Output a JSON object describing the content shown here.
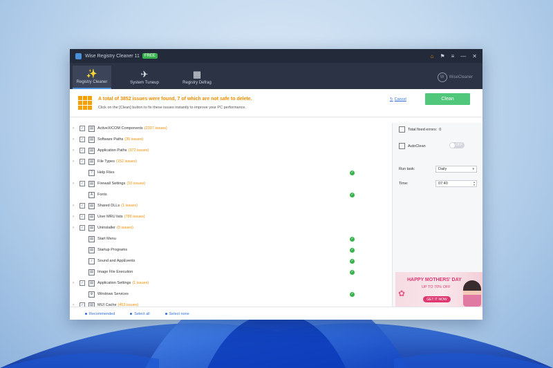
{
  "app": {
    "title": "Wise Registry Cleaner 11",
    "badge": "FREE",
    "brand": "WiseCleaner",
    "controls": [
      "⌂",
      "⚑",
      "≡",
      "—",
      "✕"
    ]
  },
  "nav": {
    "tabs": [
      {
        "label": "Registry Cleaner",
        "icon": "✨"
      },
      {
        "label": "System Tuneup",
        "icon": "✈"
      },
      {
        "label": "Registry Defrag",
        "icon": "▦"
      }
    ]
  },
  "summary": {
    "headline": "A total of 3852 issues were found, 7 of which are not safe to delete.",
    "hint": "Click on the [Clean] button to fix these issues instantly to improve your PC performance.",
    "cancel_label": "Cancel",
    "clean_label": "Clean"
  },
  "items": [
    {
      "label": "ActiveX/COM Components",
      "count": "(2337 issues)",
      "expandable": true,
      "checkbox": true,
      "icon": "▤",
      "ok": false
    },
    {
      "label": "Software Paths",
      "count": "(35 issues)",
      "expandable": true,
      "checkbox": true,
      "icon": "▤",
      "ok": false
    },
    {
      "label": "Application Paths",
      "count": "(372 issues)",
      "expandable": true,
      "checkbox": true,
      "icon": "▤",
      "ok": false
    },
    {
      "label": "File Types",
      "count": "(152 issues)",
      "expandable": true,
      "checkbox": true,
      "icon": "▤",
      "ok": false
    },
    {
      "label": "Help Files",
      "count": "",
      "expandable": false,
      "checkbox": false,
      "icon": "?",
      "ok": true
    },
    {
      "label": "Firewall Settings",
      "count": "(10 issues)",
      "expandable": true,
      "checkbox": true,
      "icon": "▤",
      "ok": false
    },
    {
      "label": "Fonts",
      "count": "",
      "expandable": false,
      "checkbox": false,
      "icon": "A",
      "ok": true
    },
    {
      "label": "Shared DLLs",
      "count": "(1 issues)",
      "expandable": true,
      "checkbox": true,
      "icon": "▤",
      "ok": false
    },
    {
      "label": "User MRU lists",
      "count": "(786 issues)",
      "expandable": true,
      "checkbox": true,
      "icon": "▤",
      "ok": false
    },
    {
      "label": "Uninstaller",
      "count": "(5 issues)",
      "expandable": true,
      "checkbox": true,
      "icon": "▤",
      "ok": false
    },
    {
      "label": "Start Menu",
      "count": "",
      "expandable": false,
      "checkbox": false,
      "icon": "▤",
      "ok": true
    },
    {
      "label": "Startup Programs",
      "count": "",
      "expandable": false,
      "checkbox": false,
      "icon": "▤",
      "ok": true
    },
    {
      "label": "Sound and AppEvents",
      "count": "",
      "expandable": false,
      "checkbox": false,
      "icon": "♪",
      "ok": true
    },
    {
      "label": "Image File Execution",
      "count": "",
      "expandable": false,
      "checkbox": false,
      "icon": "▤",
      "ok": true
    },
    {
      "label": "Application Settings",
      "count": "(1 issues)",
      "expandable": true,
      "checkbox": true,
      "icon": "▤",
      "ok": false
    },
    {
      "label": "Windows Services",
      "count": "",
      "expandable": false,
      "checkbox": false,
      "icon": "⚙",
      "ok": true
    },
    {
      "label": "MUI Cache",
      "count": "(453 issues)",
      "expandable": true,
      "checkbox": true,
      "icon": "▤",
      "ok": false
    }
  ],
  "side": {
    "total_fixed_label": "Total fixed errors:",
    "total_fixed_value": "0",
    "autoclean_label": "AutoClean",
    "autoclean_state": "OFF",
    "run_task_label": "Run task:",
    "run_task_value": "Daily",
    "time_label": "Time:",
    "time_value": "07:40"
  },
  "ad": {
    "title": "HAPPY MOTHERS' DAY",
    "subtitle": "UP TO 70% OFF",
    "button": "GET IT NOW"
  },
  "bottom": {
    "links": [
      "Recommended",
      "Select all",
      "Select none"
    ]
  }
}
